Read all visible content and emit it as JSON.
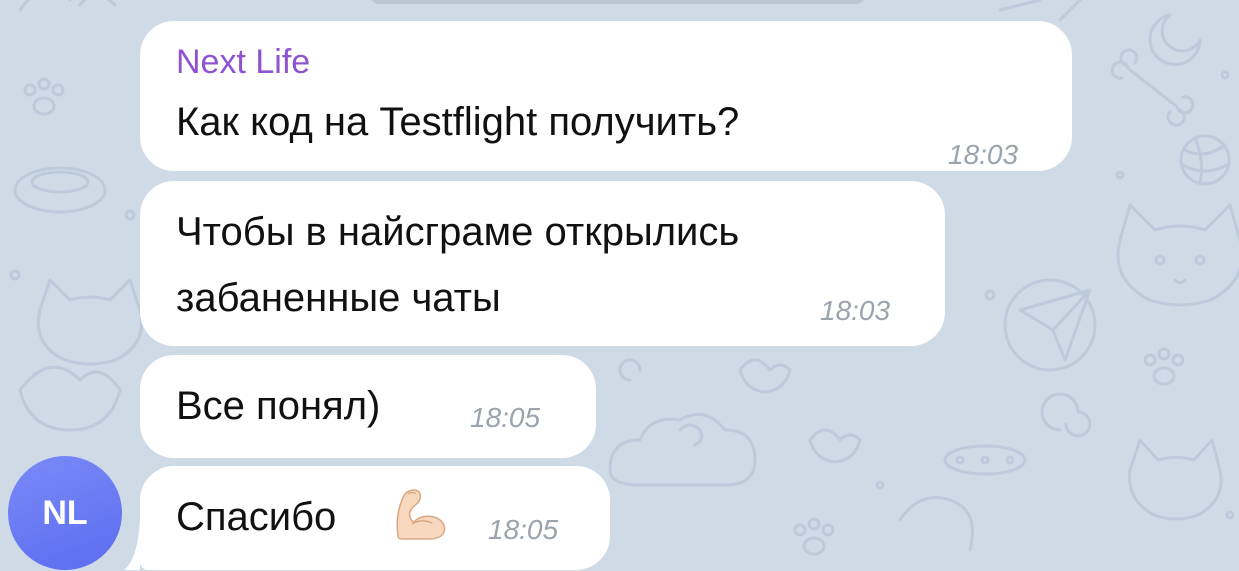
{
  "chat": {
    "sender_name": "Next Life",
    "avatar_initials": "NL",
    "messages": [
      {
        "text": "Как код на Testflight получить?",
        "time": "18:03"
      },
      {
        "line1": "Чтобы в найсграме открылись",
        "line2": "забаненные чаты",
        "time": "18:03"
      },
      {
        "text": "Все понял)",
        "time": "18:05"
      },
      {
        "text": "Спасибо",
        "emoji": "flexed-biceps-emoji",
        "time": "18:05"
      }
    ]
  },
  "colors": {
    "background": "#cfdae7",
    "bubble": "#ffffff",
    "sender_name": "#8e53d3",
    "time": "#9ba3ad",
    "avatar": "#6a7bf3"
  }
}
